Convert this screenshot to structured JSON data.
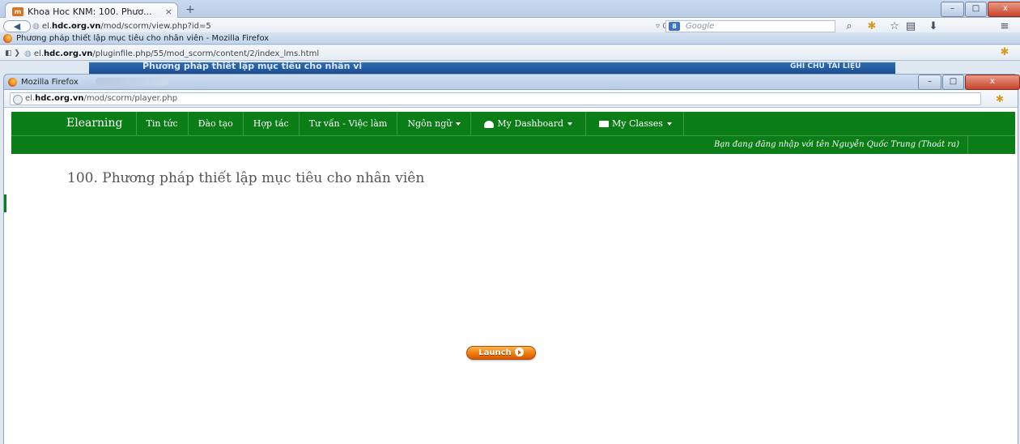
{
  "window1": {
    "tab_title": "Khoa Hoc KNM: 100. Phươ...",
    "tab_close": "×",
    "new_tab": "+",
    "url_prefix": "el.",
    "url_domain": "hdc.org.vn",
    "url_path": "/mod/scorm/view.php?id=5",
    "search_engine": "Google",
    "controls": {
      "minimize": "–",
      "maximize": "□",
      "close": "x"
    }
  },
  "window2": {
    "title": "Phương pháp thiết lập mục tiêu cho nhân viên - Mozilla Firefox",
    "url_prefix": "el.",
    "url_domain": "hdc.org.vn",
    "url_path": "/pluginfile.php/55/mod_scorm/content/2/index_lms.html"
  },
  "scorm_bar": {
    "title": "Phương pháp thiết lập mục tiêu cho nhân vi",
    "right": "GHI CHÚ   TÀI LIỆU"
  },
  "window3": {
    "title": "Mozilla Firefox",
    "url_prefix": "el.",
    "url_domain": "hdc.org.vn",
    "url_path": "/mod/scorm/player.php",
    "controls": {
      "minimize": "–",
      "maximize": "□",
      "close": "x"
    }
  },
  "site_nav": {
    "brand": "Elearning",
    "items": [
      {
        "label": "Tin tức",
        "dropdown": false
      },
      {
        "label": "Đào tạo",
        "dropdown": false
      },
      {
        "label": "Hợp tác",
        "dropdown": false
      },
      {
        "label": "Tư vấn - Việc làm",
        "dropdown": false
      },
      {
        "label": "Ngôn ngữ",
        "dropdown": true
      },
      {
        "label": "My Dashboard",
        "dropdown": true,
        "icon": "dashboard-icon"
      },
      {
        "label": "My Classes",
        "dropdown": true,
        "icon": "briefcase-icon"
      }
    ],
    "login_text": "Bạn đang đăng nhập với tên Nguyễn Quốc Trung (Thoát ra)",
    "color": "#0a7d17"
  },
  "main": {
    "page_title": "100. Phương pháp thiết lập mục tiêu cho nhân viên",
    "launch_label": "Launch"
  }
}
